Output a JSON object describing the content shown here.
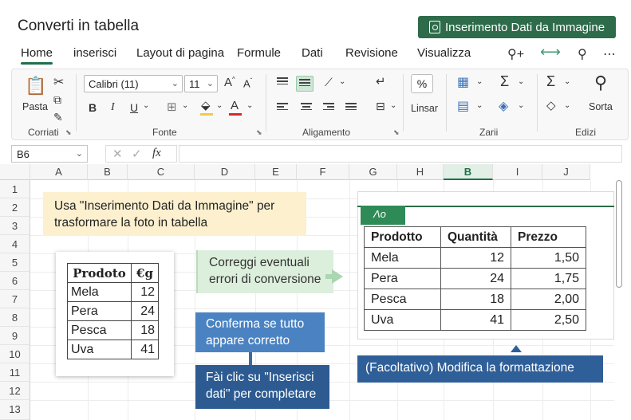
{
  "app": {
    "title": "Converti in tabella",
    "import_button": "Inserimento Dati da Immagine"
  },
  "tabs": [
    "Home",
    "inserisci",
    "Layout di pagina",
    "Formule",
    "Dati",
    "Revisione",
    "Visualizza"
  ],
  "tab_icons": [
    "people-add-icon",
    "arrows-icon",
    "search-icon",
    "more-icon"
  ],
  "ribbon": {
    "clipboard": {
      "paste": "Pasta",
      "label": "Corriati"
    },
    "font": {
      "name": "Calibri (11)",
      "size": "11",
      "grow": "A",
      "shrink": "A",
      "bold": "B",
      "italic": "I",
      "underline": "U",
      "label": "Fonte"
    },
    "alignment": {
      "label": "Aligamento"
    },
    "number": {
      "label": "Linsar",
      "percent": "%"
    },
    "cells": {
      "label": "Zarii"
    },
    "editing": {
      "sort": "Sorta",
      "label": "Edizi"
    },
    "accent_color": "#2e6b4a",
    "fill_color": "#f3c84a",
    "font_color": "#d62a2a"
  },
  "formula_bar": {
    "cell": "B6",
    "fx": "fx",
    "value": ""
  },
  "columns": [
    "A",
    "B",
    "C",
    "D",
    "E",
    "F",
    "G",
    "H",
    "B",
    "I",
    "J"
  ],
  "rows": [
    "1",
    "2",
    "3",
    "4",
    "5",
    "6",
    "7",
    "8",
    "9",
    "10",
    "11",
    "12",
    "13"
  ],
  "callouts": {
    "step1": "Usa \"Inserimento Dati da Immagine\" per trasformare la foto in tabella",
    "step2": "Correggi eventuali errori di conversione",
    "step3": "Conferma se tutto appare corretto",
    "step4": "Fài clic su \"Inserisci dati\" per completare",
    "step5": "(Facoltativo) Modifica la formattazione"
  },
  "photo_table": {
    "headers": [
      "Prodoto",
      "€g"
    ],
    "rows": [
      [
        "Mela",
        "12"
      ],
      [
        "Pera",
        "24"
      ],
      [
        "Pesca",
        "18"
      ],
      [
        "Uva",
        "41"
      ]
    ]
  },
  "result_table": {
    "tab_label": "Λo",
    "headers": [
      "Prodotto",
      "Quantità",
      "Prezzo"
    ],
    "rows": [
      [
        "Mela",
        "12",
        "1,50"
      ],
      [
        "Pera",
        "24",
        "1,75"
      ],
      [
        "Pesca",
        "18",
        "2,00"
      ],
      [
        "Uva",
        "41",
        "2,50"
      ]
    ]
  }
}
